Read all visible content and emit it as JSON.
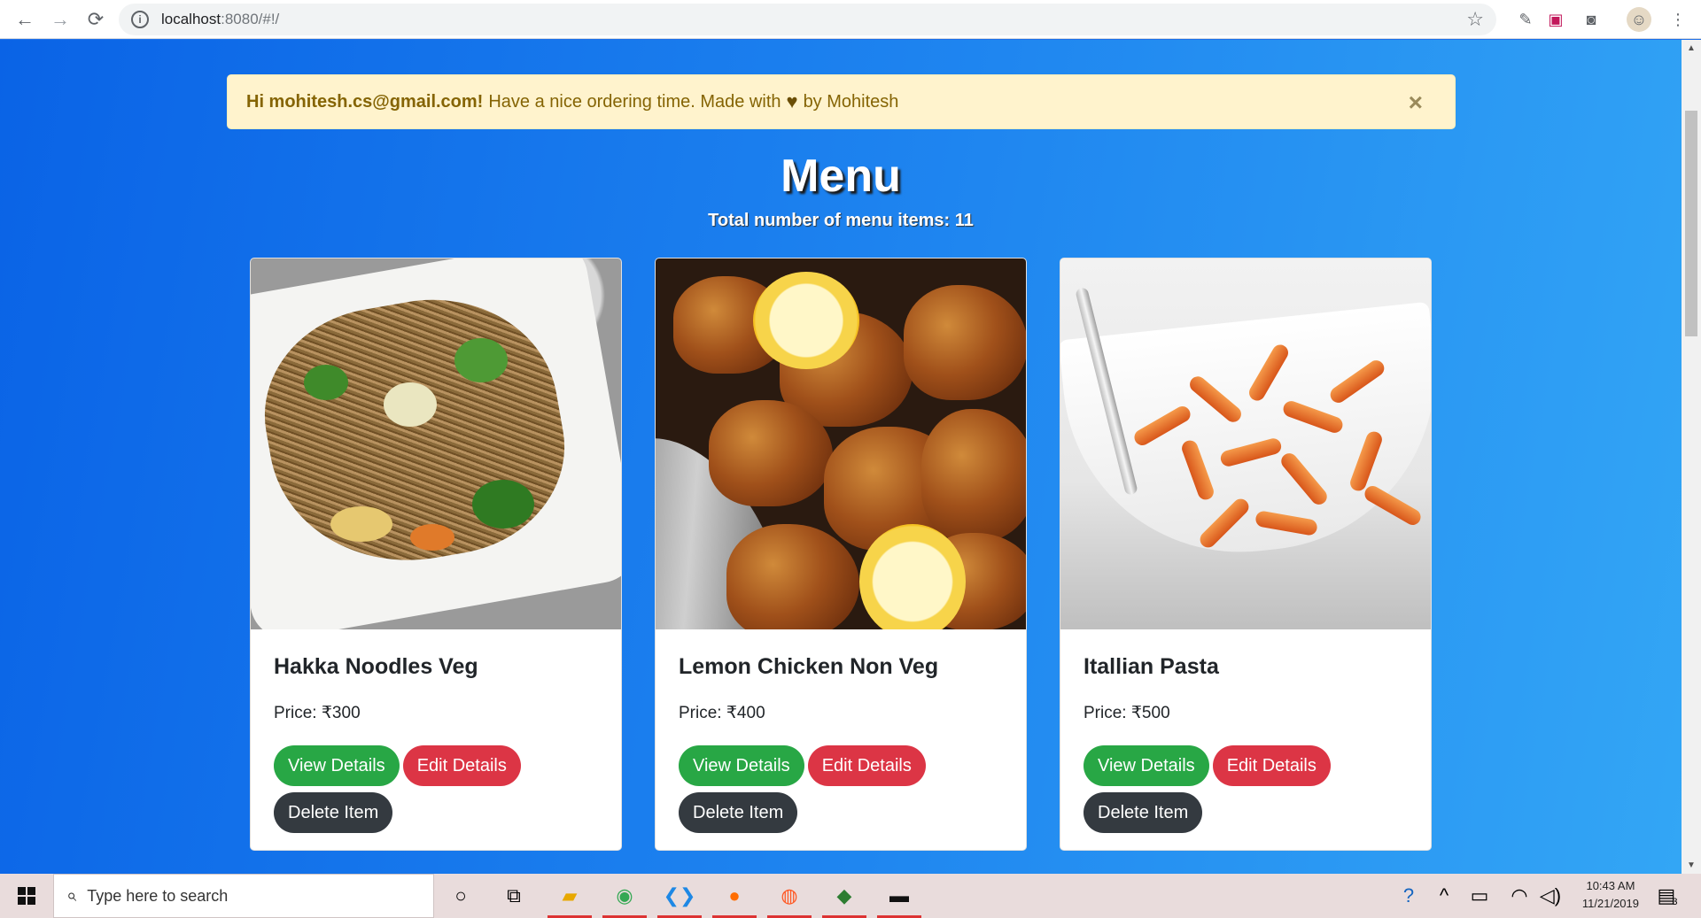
{
  "browser": {
    "url_host": "localhost",
    "url_rest": ":8080/#!/"
  },
  "alert": {
    "greeting": "Hi mohitesh.cs@gmail.com!",
    "message_before": "Have a nice ordering time. Made with",
    "message_after": "by Mohitesh",
    "close_label": "×"
  },
  "menu": {
    "title": "Menu",
    "count_text": "Total number of menu items: 11",
    "items": [
      {
        "name": "Hakka Noodles Veg",
        "price": "Price: ₹300",
        "view_label": "View Details",
        "edit_label": "Edit Details",
        "delete_label": "Delete Item"
      },
      {
        "name": "Lemon Chicken Non Veg",
        "price": "Price: ₹400",
        "view_label": "View Details",
        "edit_label": "Edit Details",
        "delete_label": "Delete Item"
      },
      {
        "name": "Itallian Pasta",
        "price": "Price: ₹500",
        "view_label": "View Details",
        "edit_label": "Edit Details",
        "delete_label": "Delete Item"
      }
    ]
  },
  "taskbar": {
    "search_placeholder": "Type here to search",
    "time": "10:43 AM",
    "date": "11/21/2019",
    "notification_count": "3"
  }
}
